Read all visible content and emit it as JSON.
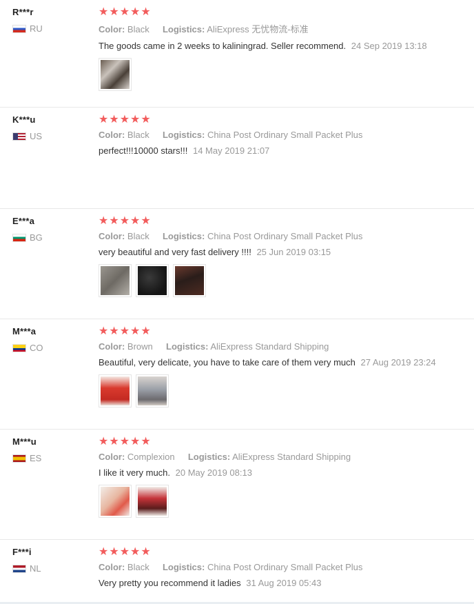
{
  "reviews": [
    {
      "user": "R***r",
      "country": "RU",
      "flag_colors": [
        "#ffffff",
        "#2d58c8",
        "#d52b1e"
      ],
      "stars": "★★★★★",
      "color_label": "Color:",
      "color_value": "Black",
      "logistics_label": "Logistics:",
      "logistics_value": "AliExpress 无忧物流-标准",
      "text": "The goods came in 2 weeks to kaliningrad. Seller recommend.",
      "date": "24 Sep 2019 13:18",
      "photos": [
        "product-photo"
      ]
    },
    {
      "user": "K***u",
      "country": "US",
      "flag_colors": [
        "#b22234",
        "#ffffff",
        "#3c3b6e"
      ],
      "stars": "★★★★★",
      "color_label": "Color:",
      "color_value": "Black",
      "logistics_label": "Logistics:",
      "logistics_value": "China Post Ordinary Small Packet Plus",
      "text": "perfect!!!10000 stars!!!",
      "date": "14 May 2019 21:07",
      "photos": []
    },
    {
      "user": "E***a",
      "country": "BG",
      "flag_colors": [
        "#ffffff",
        "#00966e",
        "#d62612"
      ],
      "stars": "★★★★★",
      "color_label": "Color:",
      "color_value": "Black",
      "logistics_label": "Logistics:",
      "logistics_value": "China Post Ordinary Small Packet Plus",
      "text": "very beautiful and very fast delivery !!!!",
      "date": "25 Jun 2019 03:15",
      "photos": [
        "package-photo",
        "fabric-photo",
        "worn-photo"
      ]
    },
    {
      "user": "M***a",
      "country": "CO",
      "flag_colors": [
        "#fcd116",
        "#003893",
        "#ce1126"
      ],
      "stars": "★★★★★",
      "color_label": "Color:",
      "color_value": "Brown",
      "logistics_label": "Logistics:",
      "logistics_value": "AliExpress Standard Shipping",
      "text": "Beautiful, very delicate, you have to take care of them very much",
      "date": "27 Aug 2019 23:24",
      "photos": [
        "red-dress-photo",
        "outfit-photo"
      ]
    },
    {
      "user": "M***u",
      "country": "ES",
      "flag_colors": [
        "#aa151b",
        "#f1bf00",
        "#aa151b"
      ],
      "stars": "★★★★★",
      "color_label": "Color:",
      "color_value": "Complexion",
      "logistics_label": "Logistics:",
      "logistics_value": "AliExpress Standard Shipping",
      "text": "I like it very much.",
      "date": "20 May 2019 08:13",
      "photos": [
        "leg-photo",
        "shoes-photo"
      ]
    },
    {
      "user": "F***i",
      "country": "NL",
      "flag_colors": [
        "#ae1c28",
        "#ffffff",
        "#21468b"
      ],
      "stars": "★★★★★",
      "color_label": "Color:",
      "color_value": "Black",
      "logistics_label": "Logistics:",
      "logistics_value": "China Post Ordinary Small Packet Plus",
      "text": "Very pretty you recommend it ladies",
      "date": "31 Aug 2019 05:43",
      "photos": []
    }
  ],
  "colors": {
    "star": "#f25c5c",
    "muted": "#999999",
    "text": "#333333"
  }
}
